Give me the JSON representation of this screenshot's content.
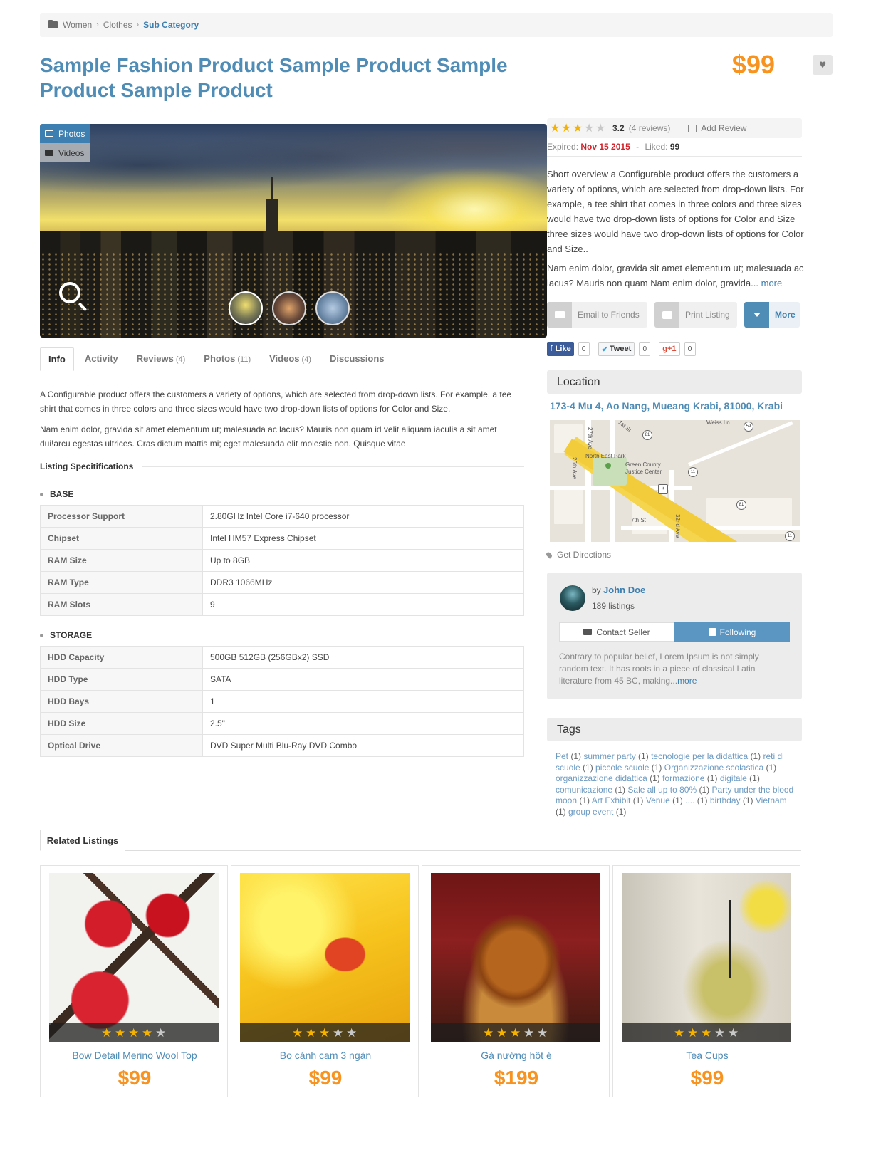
{
  "breadcrumb": {
    "items": [
      "Women",
      "Clothes"
    ],
    "current": "Sub Category"
  },
  "product": {
    "title": "Sample Fashion Product Sample Product Sample Product Sample Product",
    "price": "$99"
  },
  "gallery": {
    "photos_tab": "Photos",
    "videos_tab": "Videos"
  },
  "tabs": [
    {
      "label": "Info",
      "count": ""
    },
    {
      "label": "Activity",
      "count": ""
    },
    {
      "label": "Reviews",
      "count": "(4)"
    },
    {
      "label": "Photos",
      "count": "(11)"
    },
    {
      "label": "Videos",
      "count": "(4)"
    },
    {
      "label": "Discussions",
      "count": ""
    }
  ],
  "description": {
    "p1": "A Configurable product offers the customers a variety of options, which are selected from drop-down lists. For example, a tee shirt that comes in three colors and three sizes would have two drop-down lists of options for Color and Size.",
    "p2": "Nam enim dolor, gravida sit amet elementum ut; malesuada ac lacus? Mauris non quam id velit aliquam iaculis a sit amet dui!arcu egestas ultrices. Cras dictum mattis mi; eget malesuada elit molestie non. Quisque vitae"
  },
  "specs": {
    "heading": "Listing Specitifications",
    "base_title": "BASE",
    "base": [
      {
        "k": "Processor Support",
        "v": "2.80GHz Intel Core i7-640 processor"
      },
      {
        "k": "Chipset",
        "v": "Intel HM57 Express Chipset"
      },
      {
        "k": "RAM Size",
        "v": "Up to 8GB"
      },
      {
        "k": "RAM Type",
        "v": "DDR3 1066MHz"
      },
      {
        "k": "RAM Slots",
        "v": "9"
      }
    ],
    "storage_title": "STORAGE",
    "storage": [
      {
        "k": "HDD Capacity",
        "v": "500GB 512GB (256GBx2) SSD"
      },
      {
        "k": "HDD Type",
        "v": "SATA"
      },
      {
        "k": "HDD Bays",
        "v": "1"
      },
      {
        "k": "HDD Size",
        "v": "2.5\""
      },
      {
        "k": "Optical Drive",
        "v": "DVD Super Multi Blu-Ray DVD Combo"
      }
    ]
  },
  "rating": {
    "stars": 3,
    "max": 5,
    "score": "3.2",
    "reviews": "(4 reviews)",
    "add_review": "Add Review"
  },
  "meta": {
    "expired_label": "Expired:",
    "expired_date": "Nov 15 2015",
    "liked_label": "Liked:",
    "liked": "99"
  },
  "overview": {
    "p1": "Short overview a Configurable product offers the customers a variety of options, which are selected from drop-down lists. For example, a tee shirt that comes in three colors and three sizes would have two drop-down lists of options for Color and Size three sizes would have two drop-down lists of options for Color and Size..",
    "p2": "Nam enim dolor, gravida sit amet elementum ut; malesuada ac lacus? Mauris non quam Nam enim dolor, gravida...",
    "more": "more"
  },
  "actions": {
    "email": "Email to Friends",
    "print": "Print Listing",
    "more": "More"
  },
  "social": {
    "like": "Like",
    "like_count": "0",
    "tweet": "Tweet",
    "tweet_count": "0",
    "gplus": "+1",
    "gplus_count": "0"
  },
  "location": {
    "title": "Location",
    "address": "173-4 Mu 4, Ao Nang, Mueang Krabi, 81000, Krabi",
    "directions": "Get Directions",
    "map_labels": {
      "park": "North East Park",
      "justice": "Green County Justice Center",
      "ave27": "27th Ave",
      "ave26": "26th Ave",
      "st1": "1st St",
      "st7": "7th St",
      "ave32": "32nd Ave",
      "weiss": "Weiss Ln"
    }
  },
  "seller": {
    "by": "by",
    "name": "John Doe",
    "listings": "189 listings",
    "contact": "Contact Seller",
    "following": "Following",
    "bio": "Contrary to popular belief, Lorem Ipsum is not simply random text. It has roots in a piece of classical Latin literature from 45 BC, making...",
    "more": "more"
  },
  "tags": {
    "title": "Tags",
    "items": [
      {
        "name": "Pet",
        "count": "(1)"
      },
      {
        "name": "summer party",
        "count": "(1)"
      },
      {
        "name": "tecnologie per la didattica",
        "count": "(1)"
      },
      {
        "name": "reti di scuole",
        "count": "(1)"
      },
      {
        "name": "piccole scuole",
        "count": "(1)"
      },
      {
        "name": "Organizzazione scolastica",
        "count": "(1)"
      },
      {
        "name": "organizzazione didattica",
        "count": "(1)"
      },
      {
        "name": "formazione",
        "count": "(1)"
      },
      {
        "name": "digitale",
        "count": "(1)"
      },
      {
        "name": "comunicazione",
        "count": "(1)"
      },
      {
        "name": "Sale all up to 80%",
        "count": "(1)"
      },
      {
        "name": "Party under the blood moon",
        "count": "(1)"
      },
      {
        "name": "Art Exhibit",
        "count": "(1)"
      },
      {
        "name": "Venue",
        "count": "(1)"
      },
      {
        "name": "....",
        "count": "(1)"
      },
      {
        "name": "birthday",
        "count": "(1)"
      },
      {
        "name": "Vietnam",
        "count": "(1)"
      },
      {
        "name": "group event",
        "count": "(1)"
      }
    ]
  },
  "related": {
    "title": "Related Listings",
    "items": [
      {
        "name": "Bow Detail Merino Wool Top",
        "price": "$99",
        "stars": 4,
        "image": "red-maple-leaves"
      },
      {
        "name": "Bọ cánh cam 3 ngàn",
        "price": "$99",
        "stars": 3,
        "image": "ladybug-on-yellow-petal"
      },
      {
        "name": "Gà nướng hột é",
        "price": "$199",
        "stars": 3,
        "image": "roast-turkey"
      },
      {
        "name": "Tea Cups",
        "price": "$99",
        "stars": 3,
        "image": "glass-teapot"
      }
    ]
  },
  "colors": {
    "accent": "#4f8cb6",
    "price": "#f7931e",
    "date": "#d3222a",
    "star": "#f5b300"
  }
}
